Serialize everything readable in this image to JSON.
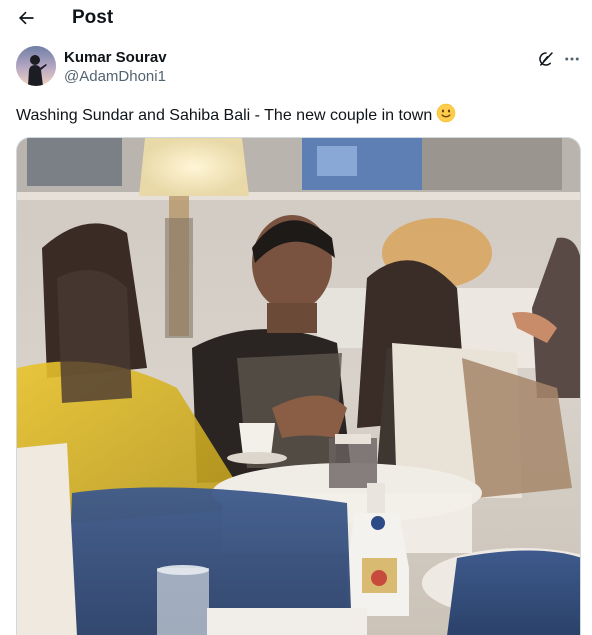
{
  "header": {
    "title": "Post",
    "back_icon": "arrow-left-icon"
  },
  "post": {
    "author": {
      "name": "Kumar Sourav",
      "handle": "@AdamDhoni1",
      "avatar_icon": "avatar-silhouette"
    },
    "actions": {
      "grok_icon": "grok-icon",
      "more_icon": "more-horizontal-icon"
    },
    "text": "Washing Sundar and Sahiba Bali - The new couple in town",
    "emoji": "slightly-smiling-face",
    "media": {
      "type": "video-frame",
      "description_icon": "restaurant-scene"
    }
  },
  "colors": {
    "text_primary": "#0f1419",
    "text_secondary": "#536471",
    "border": "#cfd9de"
  }
}
